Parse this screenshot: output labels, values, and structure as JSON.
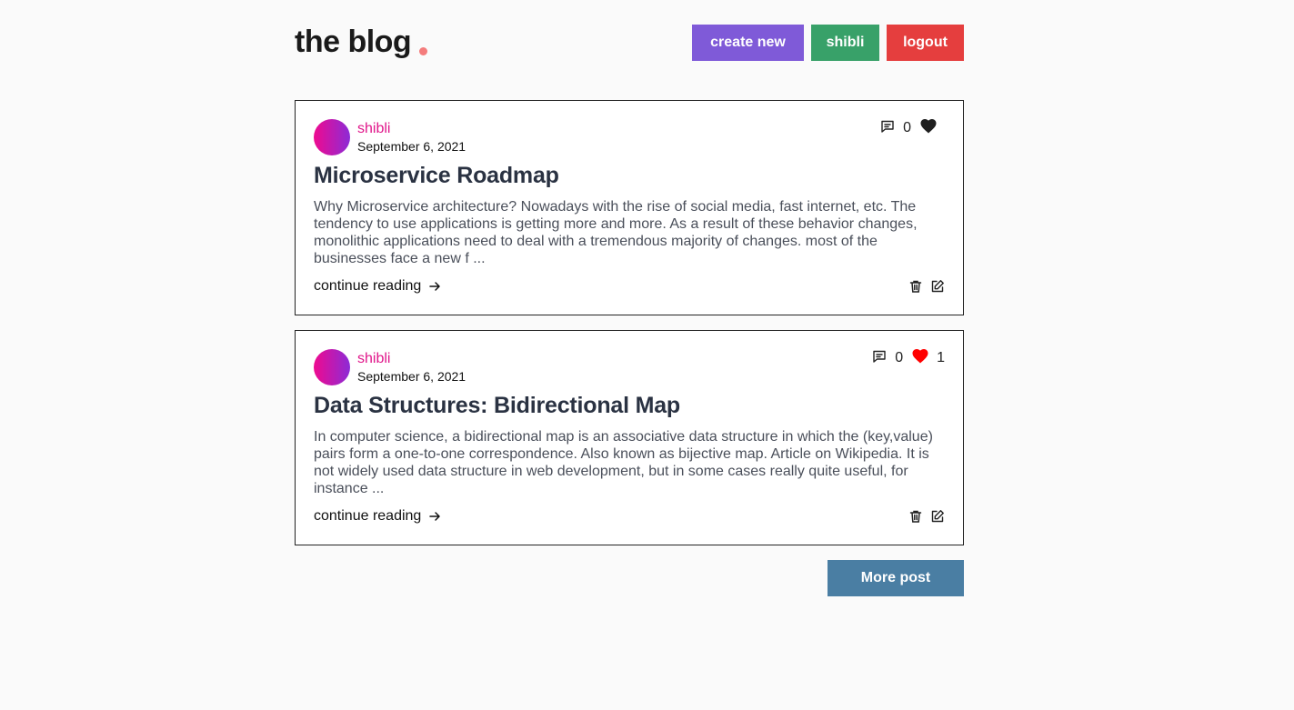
{
  "header": {
    "logo_text": "the blog",
    "create_label": "create new",
    "user_label": "shibli",
    "logout_label": "logout"
  },
  "colors": {
    "logo_dot": "#f47c7c",
    "create": "#7f5ad8",
    "user": "#38a169",
    "logout": "#e53e3e",
    "more": "#4a7ea3",
    "author": "#e0168a",
    "like_active": "#ff0000",
    "like_inactive": "#1f1f1f"
  },
  "posts": [
    {
      "author": "shibli",
      "date": "September 6, 2021",
      "title": "Microservice Roadmap",
      "excerpt": "Why Microservice architecture? Nowadays with the rise of social media, fast internet, etc. The tendency to use applications is getting more and more. As a result of these behavior changes, monolithic applications need to deal with a tremendous majority of changes. most of the businesses face a new f ...",
      "comments": "0",
      "likes": "",
      "liked": false,
      "read_more": "continue reading"
    },
    {
      "author": "shibli",
      "date": "September 6, 2021",
      "title": "Data Structures: Bidirectional Map",
      "excerpt": "In computer science, a bidirectional map is an associative data structure in which the (key,value) pairs form a one-to-one correspondence. Also known as bijective map. Article on Wikipedia. It is not widely used data structure in web development, but in some cases really quite useful, for instance ...",
      "comments": "0",
      "likes": "1",
      "liked": true,
      "read_more": "continue reading"
    }
  ],
  "more_label": "More post",
  "icons": {
    "comment": "comment-icon",
    "like": "heart-icon",
    "arrow": "arrow-right-icon",
    "delete": "trash-icon",
    "edit": "edit-icon"
  }
}
